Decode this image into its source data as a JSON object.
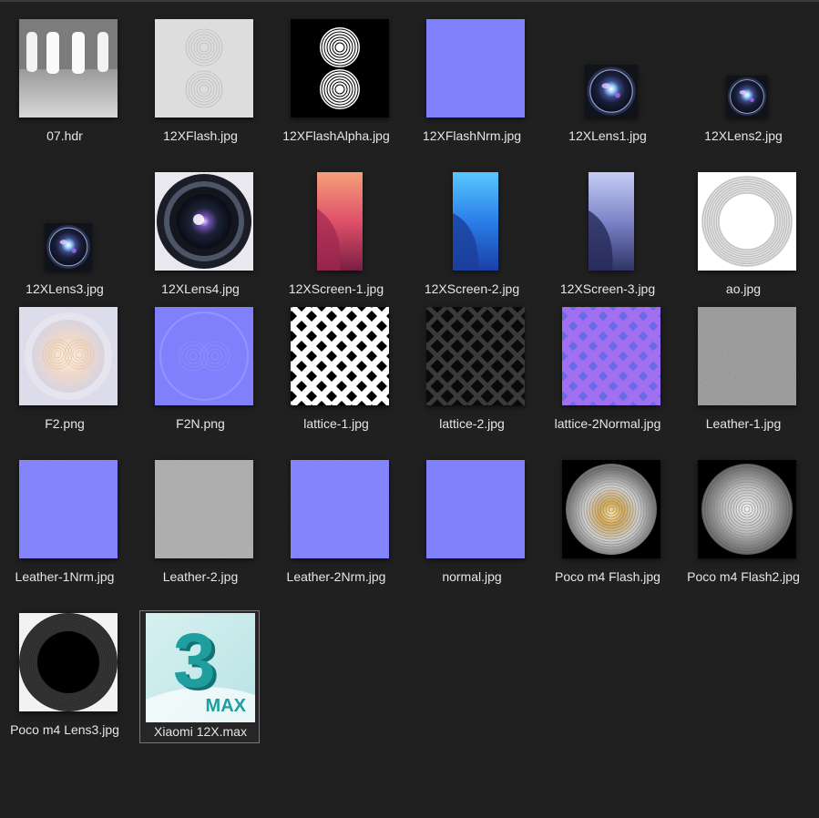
{
  "files": [
    {
      "name": "07.hdr",
      "icon": "hdr-room-thumbnail"
    },
    {
      "name": "12XFlash.jpg",
      "icon": "flash-rings-light-thumbnail"
    },
    {
      "name": "12XFlashAlpha.jpg",
      "icon": "flash-rings-alpha-thumbnail"
    },
    {
      "name": "12XFlashNrm.jpg",
      "icon": "normal-map-flat-thumbnail"
    },
    {
      "name": "12XLens1.jpg",
      "icon": "lens-thumbnail"
    },
    {
      "name": "12XLens2.jpg",
      "icon": "lens-thumbnail"
    },
    {
      "name": "12XLens3.jpg",
      "icon": "lens-thumbnail"
    },
    {
      "name": "12XLens4.jpg",
      "icon": "lens-closeup-thumbnail"
    },
    {
      "name": "12XScreen-1.jpg",
      "icon": "wallpaper-red-thumbnail"
    },
    {
      "name": "12XScreen-2.jpg",
      "icon": "wallpaper-blue-thumbnail"
    },
    {
      "name": "12XScreen-3.jpg",
      "icon": "wallpaper-lavender-thumbnail"
    },
    {
      "name": "ao.jpg",
      "icon": "ao-ring-thumbnail"
    },
    {
      "name": "F2.png",
      "icon": "flash-glow-thumbnail"
    },
    {
      "name": "F2N.png",
      "icon": "flash-normal-thumbnail"
    },
    {
      "name": "lattice-1.jpg",
      "icon": "lattice-white-thumbnail"
    },
    {
      "name": "lattice-2.jpg",
      "icon": "lattice-dark-thumbnail"
    },
    {
      "name": "lattice-2Normal.jpg",
      "icon": "lattice-normal-thumbnail"
    },
    {
      "name": "Leather-1.jpg",
      "icon": "leather-gray-thumbnail"
    },
    {
      "name": "Leather-1Nrm.jpg",
      "icon": "leather-normal-thumbnail"
    },
    {
      "name": "Leather-2.jpg",
      "icon": "leather-bump-thumbnail"
    },
    {
      "name": "Leather-2Nrm.jpg",
      "icon": "leather-normal-thumbnail"
    },
    {
      "name": "normal.jpg",
      "icon": "normal-map-flat-thumbnail"
    },
    {
      "name": "Poco m4 Flash.jpg",
      "icon": "flash-warm-thumbnail"
    },
    {
      "name": "Poco m4 Flash2.jpg",
      "icon": "flash-silver-thumbnail"
    },
    {
      "name": "Poco m4 Lens3.jpg",
      "icon": "lens-ring-black-thumbnail"
    },
    {
      "name": "Xiaomi 12X.max",
      "icon": "3ds-max-icon",
      "selected": true
    }
  ],
  "max_icon": {
    "numeral": "3",
    "text": "MAX"
  }
}
